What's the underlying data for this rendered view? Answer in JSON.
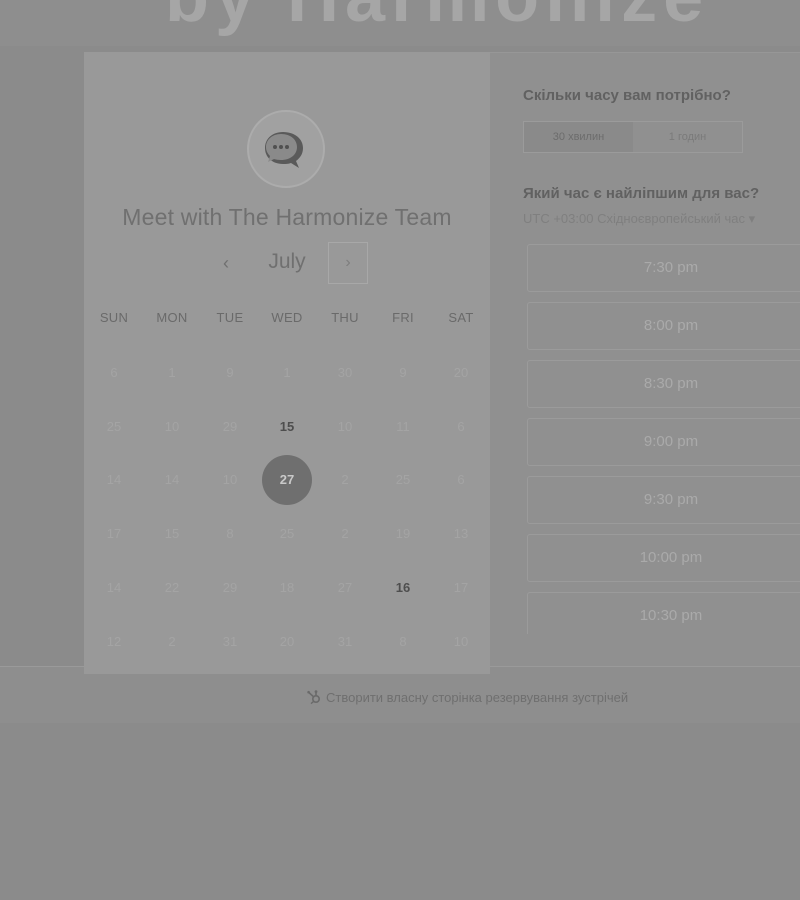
{
  "header": {
    "brand_text": "by Harmonize"
  },
  "calendar": {
    "title": "Meet with The Harmonize Team",
    "month": "July",
    "prev_icon": "chevron-left-icon",
    "next_icon": "chevron-right-icon",
    "weekdays": [
      "SUN",
      "MON",
      "TUE",
      "WED",
      "THU",
      "FRI",
      "SAT"
    ],
    "weeks": [
      [
        "6",
        "1",
        "9",
        "1",
        "30",
        "9",
        "20"
      ],
      [
        "25",
        "10",
        "29",
        "15",
        "10",
        "11",
        "6"
      ],
      [
        "14",
        "14",
        "10",
        "27",
        "2",
        "25",
        "6"
      ],
      [
        "17",
        "15",
        "8",
        "25",
        "2",
        "19",
        "13"
      ],
      [
        "14",
        "22",
        "29",
        "18",
        "27",
        "16",
        "17"
      ],
      [
        "12",
        "2",
        "31",
        "20",
        "31",
        "8",
        "10"
      ]
    ],
    "available_days": [
      "15",
      "16"
    ],
    "selected_day": "27"
  },
  "duration": {
    "heading": "Скільки часу вам потрібно?",
    "options": [
      "30 хвилин",
      "1 годин"
    ],
    "selected": "30 хвилин"
  },
  "time": {
    "heading": "Який час є найліпшим для вас?",
    "timezone": "UTC +03:00 Східноєвропейський час ▾",
    "slots": [
      "7:30 pm",
      "8:00 pm",
      "8:30 pm",
      "9:00 pm",
      "9:30 pm",
      "10:00 pm",
      "10:30 pm"
    ]
  },
  "footer": {
    "link_text": "Створити власну сторінка резервування зустрічей",
    "icon": "hubspot-sprocket-icon"
  },
  "colors": {
    "overlay_gray": "#8b8b8b",
    "panel_gray": "#999999",
    "selected_day": "#6f6f6f"
  }
}
